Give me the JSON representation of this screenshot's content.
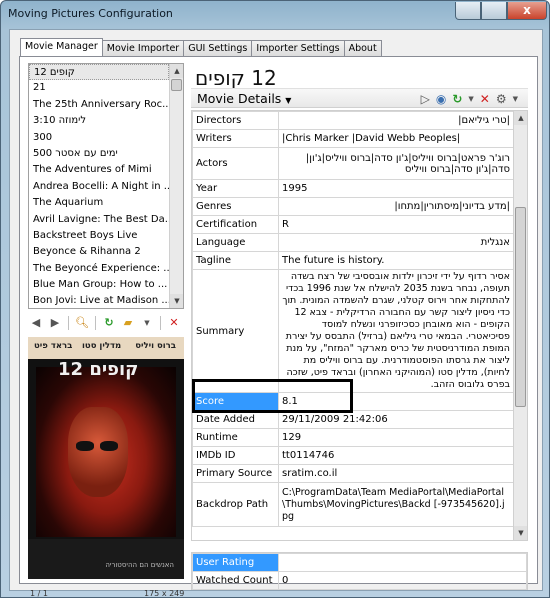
{
  "window": {
    "title": "Moving Pictures Configuration",
    "close_label": "x"
  },
  "tabs": [
    "Movie Manager",
    "Movie Importer",
    "GUI Settings",
    "Importer Settings",
    "About"
  ],
  "movie_list": [
    "קופים 12",
    "21",
    "The 25th Anniversary Roc...",
    "לימוזה 3:10",
    "300",
    "ימים עם אסטר 500",
    "The Adventures of Mimi",
    "Andrea Bocelli: A Night in ...",
    "The Aquarium",
    "Avril Lavigne: The Best Da...",
    "Backstreet Boys Live",
    "Beyonce & Rihanna 2",
    "The Beyoncé Experience: ...",
    "Blue Man Group: How to ...",
    "Bon Jovi: Live at Madison ..."
  ],
  "poster": {
    "actor_names": [
      "ברוס ויליס",
      "מדלין סטו",
      "בראד פיט"
    ],
    "title": "12 קופים",
    "caption": "האנשים הם ההיסטוריה"
  },
  "image_info": {
    "counter": "1 / 1",
    "size": "175 x 249"
  },
  "movie": {
    "title": "12 קופים",
    "section": "Movie Details",
    "fields": [
      {
        "key": "Directors",
        "value": "|טרי גיליאם|"
      },
      {
        "key": "Writers",
        "value": "|Chris Marker |David Webb Peoples|",
        "ltr": true
      },
      {
        "key": "Actors",
        "value": "רוג'ר פראט|ברוס וויליס|ג'ון סדה|ברוס וויליס|ג'ון| סדה|ג'ון סדה|ברוס וויליס"
      },
      {
        "key": "Year",
        "value": "1995",
        "ltr": true
      },
      {
        "key": "Genres",
        "value": "|מדע בדיוני|מיסתורין|מתחו|"
      },
      {
        "key": "Certification",
        "value": "R",
        "ltr": true
      },
      {
        "key": "Language",
        "value": "אנגלית"
      },
      {
        "key": "Tagline",
        "value": "The future is history.",
        "ltr": true
      },
      {
        "key": "Summary",
        "value": "אסיר רדוף על ידי זיכרון ילדות אובססיבי של רצח בשדה תעופה, נבחר בשנת 2035 להישלח אל שנת 1996 בכדי להתחקות אחר וירוס קטלני, שגרם להשמדה המונית. תוך כדי ניסיון ליצור קשר עם החבורה הרדיקלית - צבא 12 הקופים - הוא מאובחן כסכיזופרני ונשלח למוסד פסיכיאטרי. הבמאי טרי גיליאם (ברזיל) התבסס על יצירת המופת המודרניסטית של כריס מארקר \"המזח\", על מנת ליצור את גרסתו הפוסטמודרנית. עם ברוס וויליס מת לחיות), מדלין סטו (המוהיקני האחרון) ובראד פיט, שזכה בפרס גלובוס הזהב.",
        "tall": true
      },
      {
        "key": "Score",
        "value": "8.1",
        "ltr": true
      },
      {
        "key": "Date Added",
        "value": "29/11/2009 21:42:06",
        "ltr": true
      },
      {
        "key": "Runtime",
        "value": "129",
        "ltr": true
      },
      {
        "key": "IMDb ID",
        "value": "tt0114746",
        "ltr": true
      },
      {
        "key": "Primary Source",
        "value": "sratim.co.il",
        "ltr": true
      },
      {
        "key": "Backdrop Path",
        "value": "C:\\ProgramData\\Team MediaPortal\\MediaPortal\\Thumbs\\MovingPictures\\Backd [-973545620].jpg",
        "ltr": true
      }
    ],
    "user_fields": [
      {
        "key": "User Rating",
        "value": ""
      },
      {
        "key": "Watched Count",
        "value": "0"
      }
    ]
  }
}
